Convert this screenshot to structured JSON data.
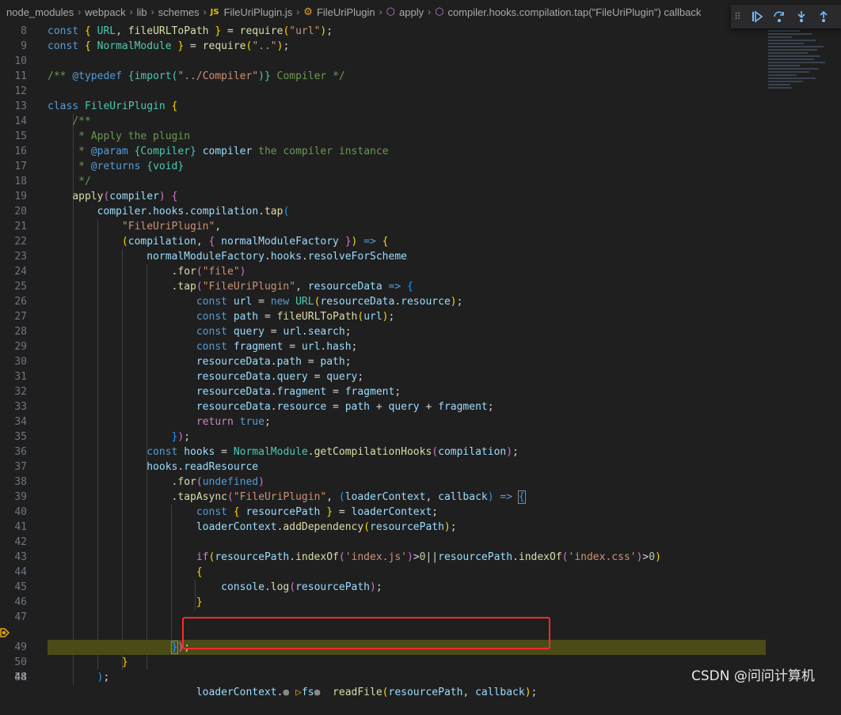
{
  "breadcrumb": {
    "items": [
      "node_modules",
      "webpack",
      "lib",
      "schemes",
      "FileUriPlugin.js",
      "FileUriPlugin",
      "apply",
      "compiler.hooks.compilation.tap(\"FileUriPlugin\") callback"
    ]
  },
  "editor": {
    "current_line": 48,
    "lines": [
      {
        "n": "8",
        "text": "const { URL, fileURLToPath } = require(\"url\");"
      },
      {
        "n": "9",
        "text": "const { NormalModule } = require(\"..\");"
      },
      {
        "n": "10",
        "text": ""
      },
      {
        "n": "11",
        "text": "/** @typedef {import(\"../Compiler\")} Compiler */"
      },
      {
        "n": "12",
        "text": ""
      },
      {
        "n": "13",
        "text": "class FileUriPlugin {"
      },
      {
        "n": "14",
        "text": "    /**"
      },
      {
        "n": "15",
        "text": "     * Apply the plugin"
      },
      {
        "n": "16",
        "text": "     * @param {Compiler} compiler the compiler instance"
      },
      {
        "n": "17",
        "text": "     * @returns {void}"
      },
      {
        "n": "18",
        "text": "     */"
      },
      {
        "n": "19",
        "text": "    apply(compiler) {"
      },
      {
        "n": "20",
        "text": "        compiler.hooks.compilation.tap("
      },
      {
        "n": "21",
        "text": "            \"FileUriPlugin\","
      },
      {
        "n": "22",
        "text": "            (compilation, { normalModuleFactory }) => {"
      },
      {
        "n": "23",
        "text": "                normalModuleFactory.hooks.resolveForScheme"
      },
      {
        "n": "24",
        "text": "                    .for(\"file\")"
      },
      {
        "n": "25",
        "text": "                    .tap(\"FileUriPlugin\", resourceData => {"
      },
      {
        "n": "26",
        "text": "                        const url = new URL(resourceData.resource);"
      },
      {
        "n": "27",
        "text": "                        const path = fileURLToPath(url);"
      },
      {
        "n": "28",
        "text": "                        const query = url.search;"
      },
      {
        "n": "29",
        "text": "                        const fragment = url.hash;"
      },
      {
        "n": "30",
        "text": "                        resourceData.path = path;"
      },
      {
        "n": "31",
        "text": "                        resourceData.query = query;"
      },
      {
        "n": "32",
        "text": "                        resourceData.fragment = fragment;"
      },
      {
        "n": "33",
        "text": "                        resourceData.resource = path + query + fragment;"
      },
      {
        "n": "34",
        "text": "                        return true;"
      },
      {
        "n": "35",
        "text": "                    });"
      },
      {
        "n": "36",
        "text": "                const hooks = NormalModule.getCompilationHooks(compilation);"
      },
      {
        "n": "37",
        "text": "                hooks.readResource"
      },
      {
        "n": "38",
        "text": "                    .for(undefined)"
      },
      {
        "n": "39",
        "text": "                    .tapAsync(\"FileUriPlugin\", (loaderContext, callback) => {"
      },
      {
        "n": "40",
        "text": "                        const { resourcePath } = loaderContext;"
      },
      {
        "n": "41",
        "text": "                        loaderContext.addDependency(resourcePath);"
      },
      {
        "n": "42",
        "text": ""
      },
      {
        "n": "43",
        "text": "                        if(resourcePath.indexOf('index.js')>0||resourcePath.indexOf('index.css')>0)"
      },
      {
        "n": "44",
        "text": "                        {"
      },
      {
        "n": "45",
        "text": "                            console.log(resourcePath);"
      },
      {
        "n": "46",
        "text": "                        }"
      },
      {
        "n": "47",
        "text": ""
      },
      {
        "n": "48",
        "text": "                        loaderContext. fs  readFile(resourcePath, callback);"
      },
      {
        "n": "49",
        "text": "                    });"
      },
      {
        "n": "50",
        "text": "            }"
      },
      {
        "n": "51",
        "text": "        );"
      }
    ]
  },
  "debug_toolbar": {
    "buttons": [
      "continue-icon",
      "step-over-icon",
      "step-into-icon",
      "step-out-icon"
    ]
  },
  "watermark": "CSDN @问问计算机",
  "colors": {
    "background": "#1f1f1f",
    "current_line": "#4b4b18",
    "highlight_box": "#ff2a2a",
    "breakpoint": "#e5a00d"
  }
}
